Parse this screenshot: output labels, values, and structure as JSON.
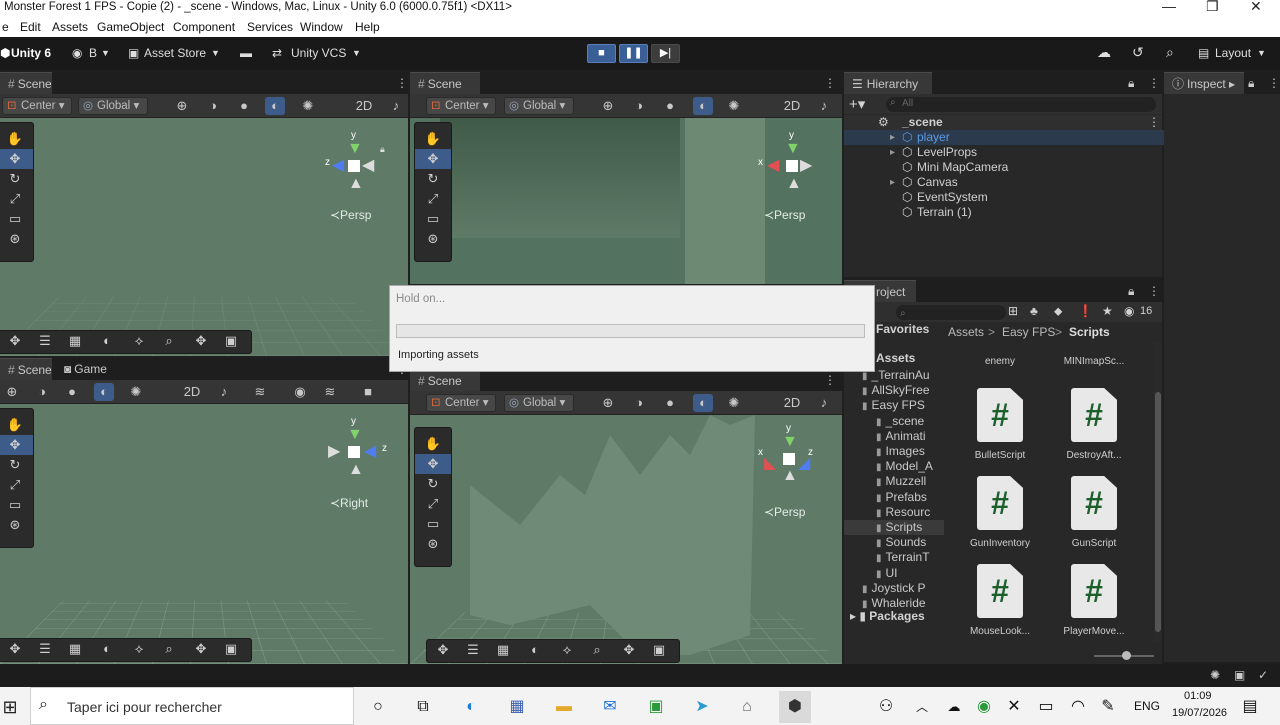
{
  "window": {
    "title": "Monster Forest 1 FPS - Copie (2) - _scene - Windows, Mac, Linux - Unity 6.0 (6000.0.75f1) <DX11>",
    "minimize": "—",
    "restore": "❐",
    "close": "✕"
  },
  "menu": [
    "e",
    "Edit",
    "Assets",
    "GameObject",
    "Component",
    "Services",
    "Window",
    "Help"
  ],
  "toolbar": {
    "unity_version": "Unity 6",
    "account": "B",
    "asset_store": "Asset Store",
    "vcs": "Unity VCS",
    "layout": "Layout"
  },
  "scene_views": {
    "tab_label": "Scene",
    "game_tab_label": "Game",
    "pivot_label": "Center",
    "space_label": "Global",
    "persp_label": "≺Persp",
    "right_label": "≺Right",
    "axis_x": "x",
    "axis_y": "y",
    "axis_z": "z"
  },
  "hierarchy": {
    "tab_label": "Hierarchy",
    "search_placeholder": "All",
    "scene_name": "_scene",
    "items": [
      {
        "label": "player",
        "selected": true,
        "expandable": true
      },
      {
        "label": "LevelProps",
        "expandable": true
      },
      {
        "label": "Mini MapCamera",
        "expandable": false
      },
      {
        "label": "Canvas",
        "expandable": true
      },
      {
        "label": "EventSystem",
        "expandable": false
      },
      {
        "label": "Terrain (1)",
        "expandable": false
      }
    ]
  },
  "inspector": {
    "tab_label": "Inspect"
  },
  "project": {
    "tab_label": "roject",
    "favorites_label": "Favorites",
    "assets_label": "Assets",
    "packages_label": "Packages",
    "badge_count": "16",
    "breadcrumb": [
      "Assets",
      "Easy FPS",
      "Scripts"
    ],
    "tree": [
      {
        "label": "_TerrainAu",
        "indent": 1
      },
      {
        "label": "AllSkyFree",
        "indent": 1
      },
      {
        "label": "Easy FPS",
        "indent": 1
      },
      {
        "label": "_scene",
        "indent": 2
      },
      {
        "label": "Animati",
        "indent": 2
      },
      {
        "label": "Images",
        "indent": 2
      },
      {
        "label": "Model_A",
        "indent": 2
      },
      {
        "label": "Muzzell",
        "indent": 2
      },
      {
        "label": "Prefabs",
        "indent": 2
      },
      {
        "label": "Resourc",
        "indent": 2
      },
      {
        "label": "Scripts",
        "indent": 2
      },
      {
        "label": "Sounds",
        "indent": 2
      },
      {
        "label": "TerrainT",
        "indent": 2
      },
      {
        "label": "UI",
        "indent": 2
      },
      {
        "label": "Joystick P",
        "indent": 1
      },
      {
        "label": "Whaleride",
        "indent": 1
      }
    ],
    "assets_top": [
      "enemy",
      "MINImapSc..."
    ],
    "assets": [
      "BulletScript",
      "DestroyAft...",
      "GunInventory",
      "GunScript",
      "MouseLook...",
      "PlayerMove..."
    ],
    "script_glyph": "#"
  },
  "dialog": {
    "title": "Hold on...",
    "message": "Importing assets",
    "progress": 0
  },
  "taskbar": {
    "search_placeholder": "Taper ici pour rechercher",
    "language": "ENG",
    "time": "01:09",
    "date": "19/07/2026"
  },
  "colors": {
    "accent": "#3e5c8a",
    "viewport": "#5f7a67",
    "selected_text": "#5a9be6"
  }
}
